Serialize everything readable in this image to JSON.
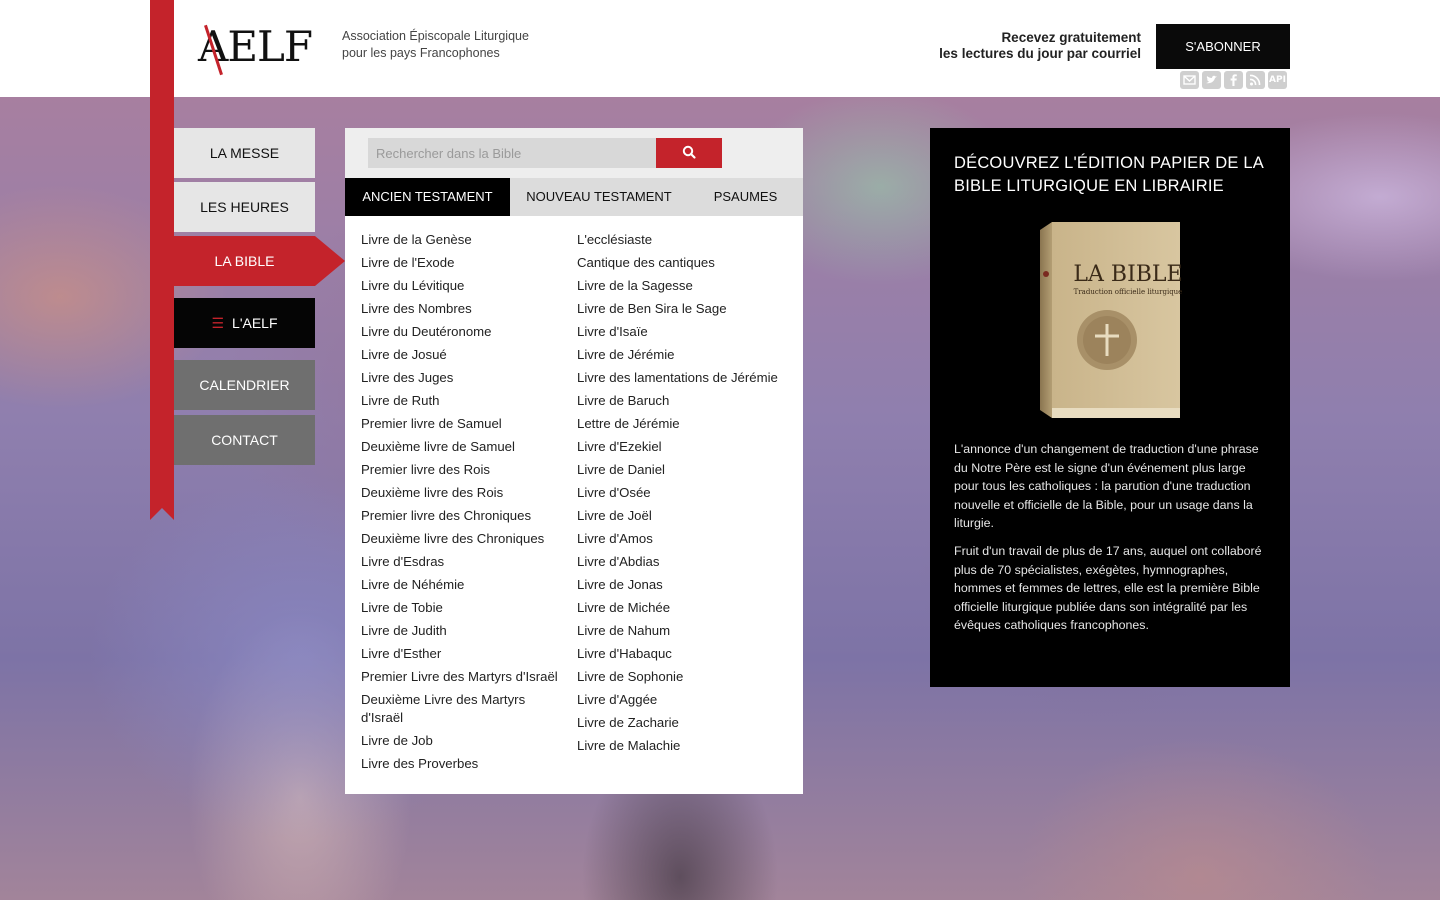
{
  "header": {
    "logo_text": "AELF",
    "tagline_line1": "Association Épiscopale Liturgique",
    "tagline_line2": "pour les pays Francophones",
    "subscribe_line1": "Recevez gratuitement",
    "subscribe_line2": "les lectures du jour par courriel",
    "subscribe_button": "S'ABONNER",
    "social_icons": [
      "mail-icon",
      "twitter-icon",
      "facebook-icon",
      "rss-icon",
      "api-icon"
    ],
    "api_label": "API"
  },
  "nav": [
    {
      "label": "LA MESSE"
    },
    {
      "label": "LES HEURES"
    },
    {
      "label": "LA BIBLE"
    },
    {
      "label": "L'AELF"
    },
    {
      "label": "CALENDRIER"
    },
    {
      "label": "CONTACT"
    }
  ],
  "bible": {
    "search_placeholder": "Rechercher dans la Bible",
    "tabs": [
      "ANCIEN TESTAMENT",
      "NOUVEAU TESTAMENT",
      "PSAUMES"
    ],
    "col1": [
      "Livre de la Genèse",
      "Livre de l'Exode",
      "Livre du Lévitique",
      "Livre des Nombres",
      "Livre du Deutéronome",
      "Livre de Josué",
      "Livre des Juges",
      "Livre de Ruth",
      "Premier livre de Samuel",
      "Deuxième livre de Samuel",
      "Premier livre des Rois",
      "Deuxième livre des Rois",
      "Premier livre des Chroniques",
      "Deuxième livre des Chroniques",
      "Livre d'Esdras",
      "Livre de Néhémie",
      "Livre de Tobie",
      "Livre de Judith",
      "Livre d'Esther",
      "Premier Livre des Martyrs d'Israël",
      "Deuxième Livre des Martyrs d'Israël",
      "Livre de Job",
      "Livre des Proverbes"
    ],
    "col2": [
      "L'ecclésiaste",
      "Cantique des cantiques",
      "Livre de la Sagesse",
      "Livre de Ben Sira le Sage",
      "Livre d'Isaïe",
      "Livre de Jérémie",
      "Livre des lamentations de Jérémie",
      "Livre de Baruch",
      "Lettre de Jérémie",
      "Livre d'Ezekiel",
      "Livre de Daniel",
      "Livre d'Osée",
      "Livre de Joël",
      "Livre d'Amos",
      "Livre d'Abdias",
      "Livre de Jonas",
      "Livre de Michée",
      "Livre de Nahum",
      "Livre d'Habaquc",
      "Livre de Sophonie",
      "Livre d'Aggée",
      "Livre de Zacharie",
      "Livre de Malachie"
    ]
  },
  "promo": {
    "title": "DÉCOUVREZ L'ÉDITION PAPIER DE LA BIBLE LITURGIQUE EN LIBRAIRIE",
    "book_title": "LA BIBLE",
    "book_subtitle": "Traduction officielle liturgique",
    "para1": "L'annonce d'un changement de traduction d'une phrase du Notre Père est le signe d'un événement plus large pour tous les catholiques : la parution d'une traduction nouvelle et officielle de la Bible, pour un usage dans la liturgie.",
    "para2": "Fruit d'un travail de plus de 17 ans, auquel ont collaboré plus de 70 spécialistes, exégètes, hymnographes, hommes et femmes de lettres, elle est la première Bible officielle liturgique publiée dans son intégralité par les évêques catholiques francophones."
  },
  "colors": {
    "accent_red": "#c4232b",
    "black": "#000000",
    "nav_light": "#e6e6e6",
    "nav_grey": "#6f6f6f"
  }
}
